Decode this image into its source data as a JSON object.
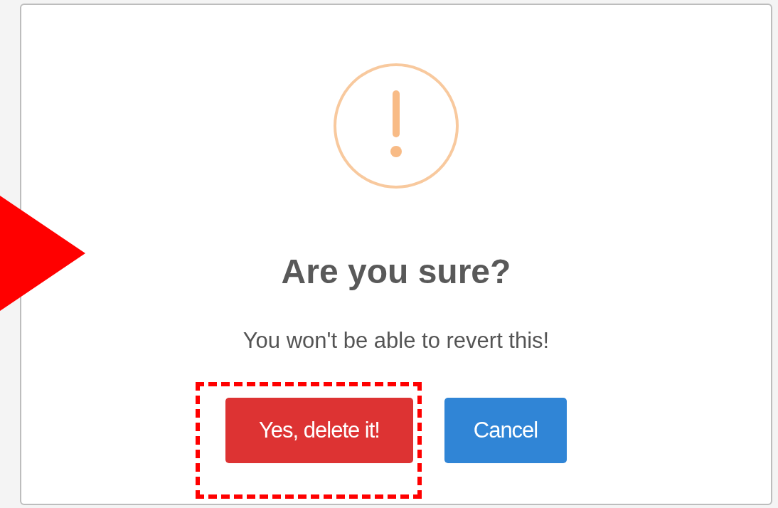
{
  "dialog": {
    "title": "Are you sure?",
    "text": "You won't be able to revert this!",
    "buttons": [
      {
        "label": "Yes, delete it!",
        "kind": "confirm",
        "highlighted": true
      },
      {
        "label": "Cancel",
        "kind": "cancel",
        "highlighted": false
      }
    ]
  },
  "annotation": {
    "arrow": true
  }
}
